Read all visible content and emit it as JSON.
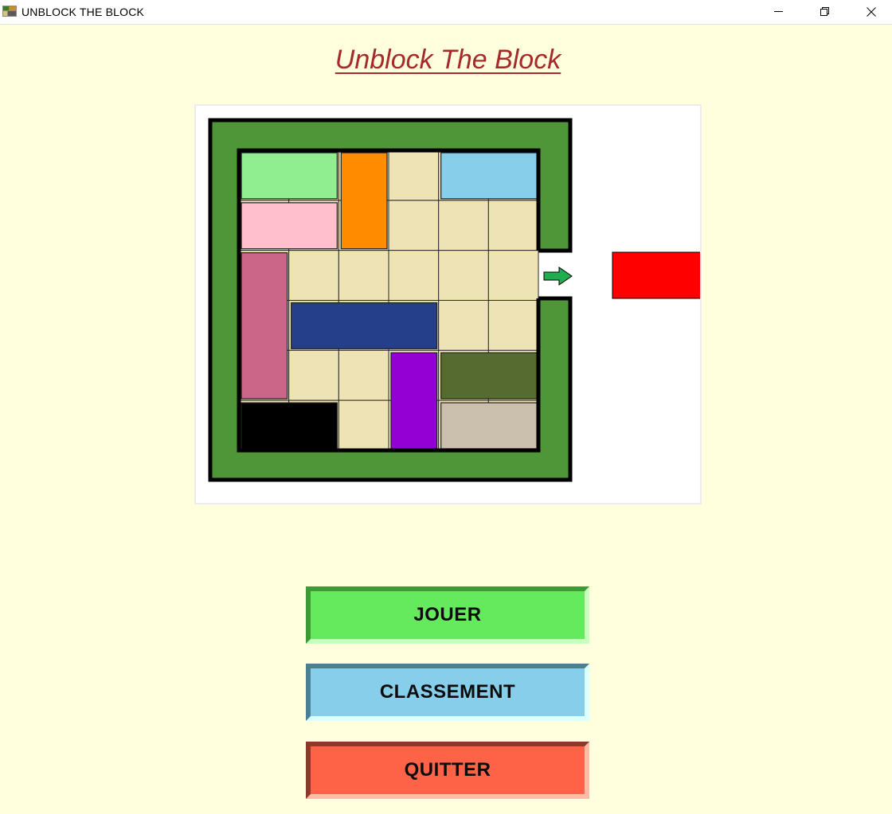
{
  "window": {
    "title": "UNBLOCK THE BLOCK",
    "controls": [
      "minimize-icon",
      "restore-icon",
      "close-icon"
    ]
  },
  "page": {
    "title": "Unblock The Block"
  },
  "board": {
    "wall_color": "#4f9638",
    "cell_color": "#eee3b4",
    "arrow_color": "#1fae4f",
    "exit_row": 3,
    "grid": {
      "columns": 6,
      "rows": 6
    },
    "blocks": [
      {
        "name": "light-green-block",
        "col": 1,
        "row": 1,
        "w": 2,
        "h": 1,
        "color": "#90ee90"
      },
      {
        "name": "orange-block",
        "col": 3,
        "row": 1,
        "w": 1,
        "h": 2,
        "color": "#ff8c00"
      },
      {
        "name": "sky-blue-block",
        "col": 5,
        "row": 1,
        "w": 2,
        "h": 1,
        "color": "#87ceeb"
      },
      {
        "name": "pink-block",
        "col": 1,
        "row": 2,
        "w": 2,
        "h": 1,
        "color": "#ffc0cb"
      },
      {
        "name": "rose-block",
        "col": 1,
        "row": 3,
        "w": 1,
        "h": 3,
        "color": "#cc6688"
      },
      {
        "name": "navy-block",
        "col": 2,
        "row": 4,
        "w": 3,
        "h": 1,
        "color": "#263f8a"
      },
      {
        "name": "purple-block",
        "col": 4,
        "row": 5,
        "w": 1,
        "h": 2,
        "color": "#9400d3"
      },
      {
        "name": "olive-block",
        "col": 5,
        "row": 5,
        "w": 2,
        "h": 1,
        "color": "#556b2f"
      },
      {
        "name": "black-block",
        "col": 1,
        "row": 6,
        "w": 2,
        "h": 1,
        "color": "#000000"
      },
      {
        "name": "beige-block",
        "col": 5,
        "row": 6,
        "w": 2,
        "h": 1,
        "color": "#cbbfae"
      }
    ],
    "target_block": {
      "name": "red-target-block",
      "color": "#ff0000"
    }
  },
  "menu": {
    "play_label": "JOUER",
    "ranking_label": "CLASSEMENT",
    "quit_label": "QUITTER"
  }
}
